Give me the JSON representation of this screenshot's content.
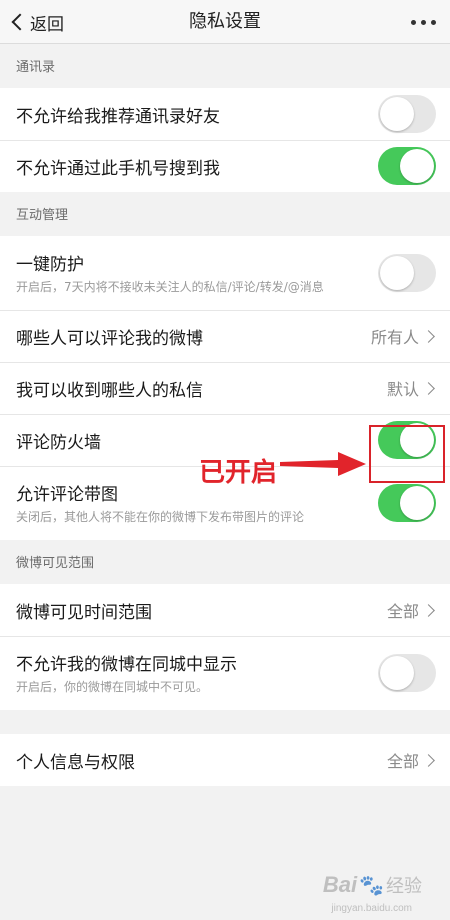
{
  "nav": {
    "back_label": "返回",
    "title": "隐私设置"
  },
  "sections": {
    "contacts": "通讯录",
    "interaction": "互动管理",
    "visibility": "微博可见范围"
  },
  "rows": {
    "no_recommend_contacts": {
      "label": "不允许给我推荐通讯录好友",
      "toggle": "off"
    },
    "no_phone_search": {
      "label": "不允许通过此手机号搜到我",
      "toggle": "on"
    },
    "one_click_protect": {
      "label": "一键防护",
      "sub": "开启后，7天内将不接收未关注人的私信/评论/转发/@消息",
      "toggle": "off"
    },
    "who_can_comment": {
      "label": "哪些人可以评论我的微博",
      "value": "所有人"
    },
    "who_can_message": {
      "label": "我可以收到哪些人的私信",
      "value": "默认"
    },
    "comment_firewall": {
      "label": "评论防火墙",
      "toggle": "on"
    },
    "allow_comment_images": {
      "label": "允许评论带图",
      "sub": "关闭后，其他人将不能在你的微博下发布带图片的评论",
      "toggle": "on"
    },
    "visible_time_range": {
      "label": "微博可见时间范围",
      "value": "全部"
    },
    "no_same_city": {
      "label": "不允许我的微博在同城中显示",
      "sub": "开启后，你的微博在同城中不可见。",
      "toggle": "off"
    },
    "personal_info": {
      "label": "个人信息与权限",
      "value": "全部"
    }
  },
  "annotation": {
    "text": "已开启",
    "color": "#e1242b"
  },
  "colors": {
    "toggle_on": "#45c95a",
    "toggle_off": "#e6e6e6",
    "highlight": "#d9232a"
  },
  "watermark": {
    "brand": "Bai",
    "suffix": "经验",
    "url": "jingyan.baidu.com"
  }
}
